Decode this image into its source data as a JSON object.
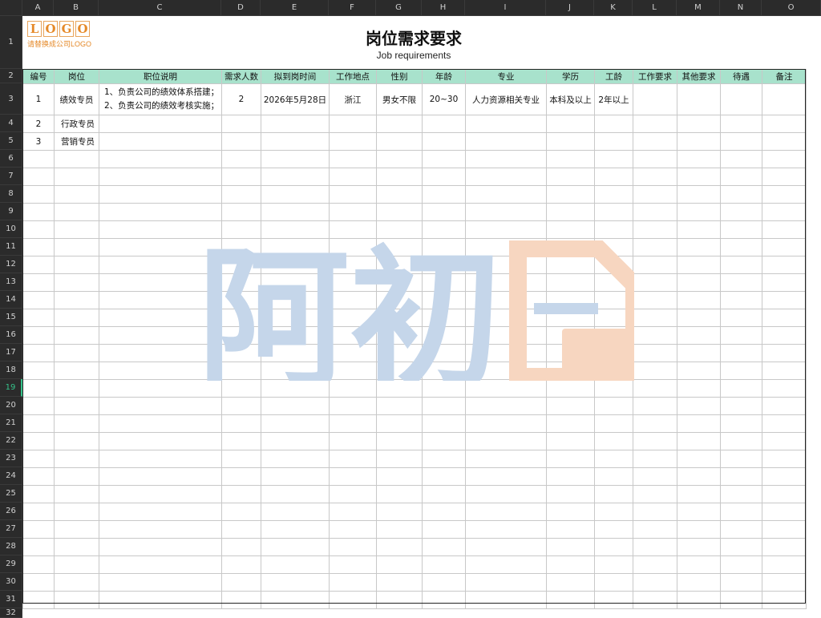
{
  "columns": [
    "A",
    "B",
    "C",
    "D",
    "E",
    "F",
    "G",
    "H",
    "I",
    "J",
    "K",
    "L",
    "M",
    "N",
    "O"
  ],
  "rows": [
    "1",
    "2",
    "3",
    "4",
    "5",
    "6",
    "7",
    "8",
    "9",
    "10",
    "11",
    "12",
    "13",
    "14",
    "15",
    "16",
    "17",
    "18",
    "19",
    "20",
    "21",
    "22",
    "23",
    "24",
    "25",
    "26",
    "27",
    "28",
    "29",
    "30",
    "31",
    "32"
  ],
  "selected_row": "19",
  "logo": {
    "letters": [
      "L",
      "O",
      "G",
      "O"
    ],
    "subtitle": "请替换成公司LOGO"
  },
  "title": {
    "zh": "岗位需求要求",
    "en": "Job requirements"
  },
  "headers": [
    "编号",
    "岗位",
    "职位说明",
    "需求人数",
    "拟到岗时间",
    "工作地点",
    "性别",
    "年龄",
    "专业",
    "学历",
    "工龄",
    "工作要求",
    "其他要求",
    "待遇",
    "备注"
  ],
  "records": [
    {
      "no": "1",
      "position": "绩效专员",
      "desc_1": "1、负责公司的绩效体系搭建；",
      "desc_2": "2、负责公司的绩效考核实施；",
      "count": "2",
      "date": "2026年5月28日",
      "location": "浙江",
      "gender": "男女不限",
      "age": "20~30",
      "major": "人力资源相关专业",
      "education": "本科及以上",
      "experience": "2年以上"
    },
    {
      "no": "2",
      "position": "行政专员"
    },
    {
      "no": "3",
      "position": "营销专员"
    }
  ],
  "watermark": {
    "text": "阿初",
    "colors": {
      "text": "#c5d6ea",
      "doc": "#f7d6c0"
    }
  }
}
